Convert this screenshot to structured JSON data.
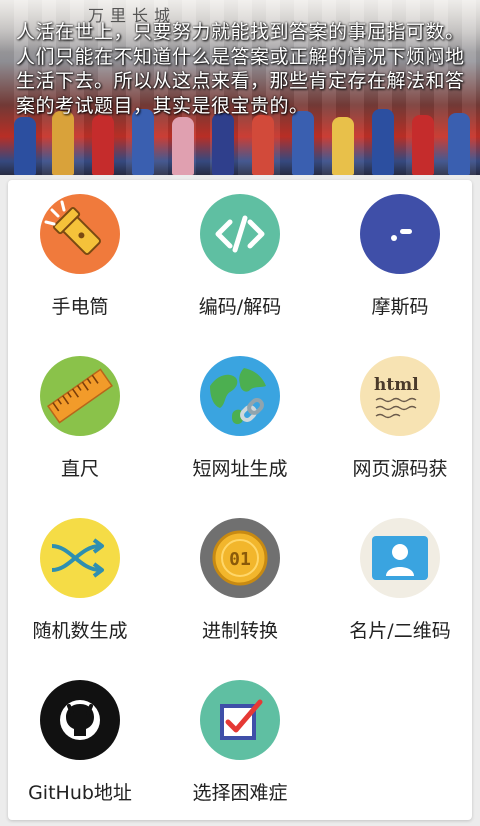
{
  "banner": {
    "quote": "人活在世上，只要努力就能找到答案的事屈指可数。人们只能在不知道什么是答案或正解的情况下烦闷地生活下去。所以从这点来看，那些肯定存在解法和答案的考试题目，其实是很宝贵的。",
    "calligraphy": "万里长城"
  },
  "tools": [
    {
      "label": "手电筒",
      "icon": "flashlight-icon",
      "color": "#f07a3c"
    },
    {
      "label": "编码/解码",
      "icon": "code-icon",
      "color": "#5fbfa2"
    },
    {
      "label": "摩斯码",
      "icon": "morse-code-icon",
      "color": "#3f4fa8"
    },
    {
      "label": "直尺",
      "icon": "ruler-icon",
      "color": "#8ac24a"
    },
    {
      "label": "短网址生成",
      "icon": "globe-link-icon",
      "color": "#3aa4e0"
    },
    {
      "label": "网页源码获",
      "icon": "html-paper-icon",
      "color": "#f7e3b3"
    },
    {
      "label": "随机数生成",
      "icon": "shuffle-icon",
      "color": "#f5dc46"
    },
    {
      "label": "进制转换",
      "icon": "binary-coin-icon",
      "color": "#707070"
    },
    {
      "label": "名片/二维码",
      "icon": "contact-card-icon",
      "color": "#f1ede3"
    },
    {
      "label": "GitHub地址",
      "icon": "github-icon",
      "color": "#111111"
    },
    {
      "label": "选择困难症",
      "icon": "checkbox-icon",
      "color": "#5fbfa2"
    }
  ]
}
